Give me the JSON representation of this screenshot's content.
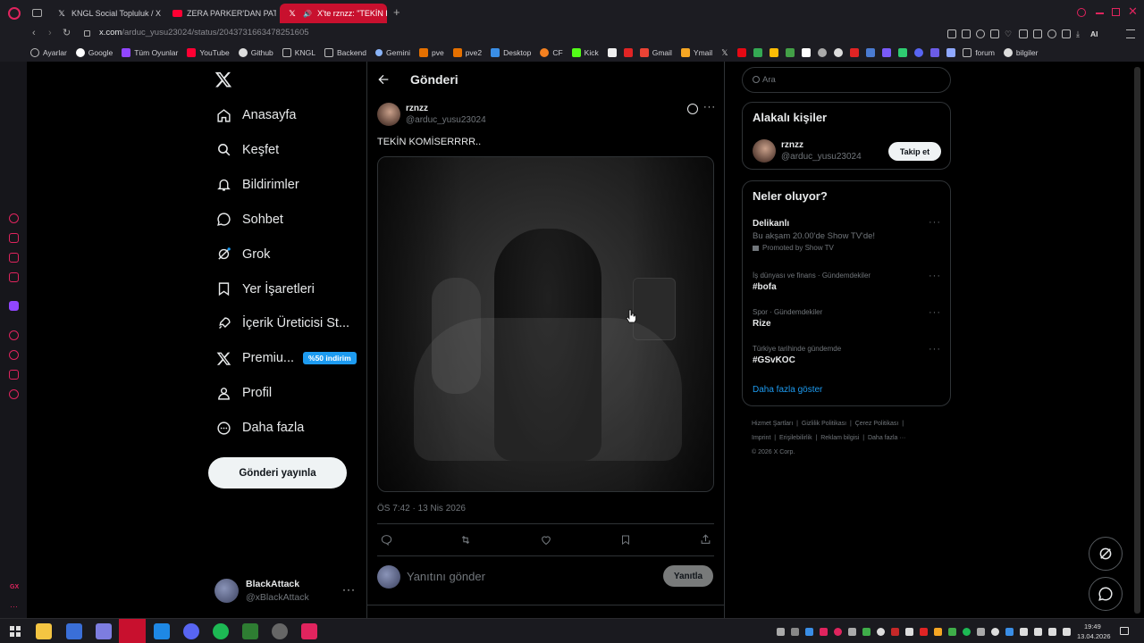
{
  "browser": {
    "tabs": [
      {
        "label": "KNGL Social Topluluk / X",
        "icon": "x-logo"
      },
      {
        "label": "ZERA PARKER'DAN PATRO",
        "icon": "youtube-icon"
      },
      {
        "label": "X'te rznzz: \"TEKİN KOM",
        "icon": "x-logo",
        "active": true
      }
    ],
    "url_host": "x.com",
    "url_path": "/arduc_yusu23024/status/2043731663478251605",
    "bookmarks": [
      "Ayarlar",
      "Google",
      "Tüm Oyunlar",
      "YouTube",
      "Github",
      "KNGL",
      "Backend",
      "Gemini",
      "pve",
      "pve2",
      "Desktop",
      "CF",
      "Kick",
      "Gmail",
      "Ymail",
      "forum",
      "bilgiler"
    ],
    "toolbar_ai_label": "AI"
  },
  "nav": {
    "items": [
      {
        "label": "Anasayfa",
        "icon": "home-icon"
      },
      {
        "label": "Keşfet",
        "icon": "search-icon"
      },
      {
        "label": "Bildirimler",
        "icon": "bell-icon"
      },
      {
        "label": "Sohbet",
        "icon": "chat-icon"
      },
      {
        "label": "Grok",
        "icon": "grok-icon"
      },
      {
        "label": "Yer İşaretleri",
        "icon": "bookmark-icon"
      },
      {
        "label": "İçerik Üreticisi St...",
        "icon": "rocket-icon"
      },
      {
        "label": "Premiu...",
        "icon": "x-logo-icon"
      },
      {
        "label": "Profil",
        "icon": "person-icon"
      },
      {
        "label": "Daha fazla",
        "icon": "more-circle-icon"
      }
    ],
    "premium_badge": "%50 indirim",
    "post_button": "Gönderi yayınla",
    "account": {
      "name": "BlackAttack",
      "handle": "@xBlackAttack"
    }
  },
  "post": {
    "header_title": "Gönderi",
    "author_name": "rznzz",
    "author_handle": "@arduc_yusu23024",
    "text": "TEKİN KOMİSERRRR..",
    "timestamp": "ÖS 7:42 · 13 Nis 2026",
    "reply_placeholder": "Yanıtını gönder",
    "reply_button": "Yanıtla"
  },
  "sidebar": {
    "search_placeholder": "Ara",
    "related_title": "Alakalı kişiler",
    "related_user": {
      "name": "rznzz",
      "handle": "@arduc_yusu23024",
      "follow": "Takip et"
    },
    "trends_title": "Neler oluyor?",
    "promoted": {
      "name": "Delikanlı",
      "desc": "Bu akşam 20.00'de Show TV'de!",
      "promoted_by": "Promoted by Show TV"
    },
    "trends": [
      {
        "category": "İş dünyası ve finans · Gündemdekiler",
        "name": "#bofa"
      },
      {
        "category": "Spor · Gündemdekiler",
        "name": "Rize"
      },
      {
        "category": "Türkiye tarihinde gündemde",
        "name": "#GSvKOC"
      }
    ],
    "show_more": "Daha fazla göster",
    "footer": [
      "Hizmet Şartları",
      "Gizlilik Politikası",
      "Çerez Politikası",
      "Imprint",
      "Erişilebilirlik",
      "Reklam bilgisi",
      "Daha fazla ···",
      "© 2026 X Corp."
    ]
  },
  "taskbar": {
    "time": "19:49",
    "date": "13.04.2026"
  },
  "colors": {
    "accent": "#1d9bf0",
    "tab_active": "#c8102e",
    "border": "#2f3336",
    "muted": "#71767b"
  }
}
